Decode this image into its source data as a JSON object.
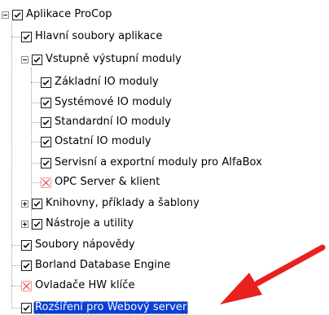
{
  "tree": {
    "items": [
      {
        "label": "Aplikace ProCop",
        "checked": true
      },
      {
        "label": "Hlavní soubory aplikace",
        "checked": true
      },
      {
        "label": "Vstupně výstupní moduly",
        "checked": true
      },
      {
        "label": "Základní IO moduly",
        "checked": true
      },
      {
        "label": "Systémové IO moduly",
        "checked": true
      },
      {
        "label": "Standardní IO moduly",
        "checked": true
      },
      {
        "label": "Ostatní IO moduly",
        "checked": true
      },
      {
        "label": "Servisní a exportní moduly pro AlfaBox",
        "checked": true
      },
      {
        "label": "OPC Server & klient",
        "checked": false
      },
      {
        "label": "Knihovny, příklady a šablony",
        "checked": true
      },
      {
        "label": "Nástroje a utility",
        "checked": true
      },
      {
        "label": "Soubory nápovědy",
        "checked": true
      },
      {
        "label": "Borland Database Engine",
        "checked": true
      },
      {
        "label": "Ovladače HW klíče",
        "checked": false
      },
      {
        "label": "Rozšíření pro Webový server",
        "checked": true,
        "selected": true
      }
    ]
  },
  "colors": {
    "selection": "#0a3ed8",
    "arrow": "#e8211e",
    "unavailable_x": "#e5393b"
  },
  "icons": {
    "checked": "checkmark-icon",
    "unavailable": "red-x-icon",
    "expanded": "minus-expander-icon",
    "collapsed": "plus-expander-icon"
  }
}
